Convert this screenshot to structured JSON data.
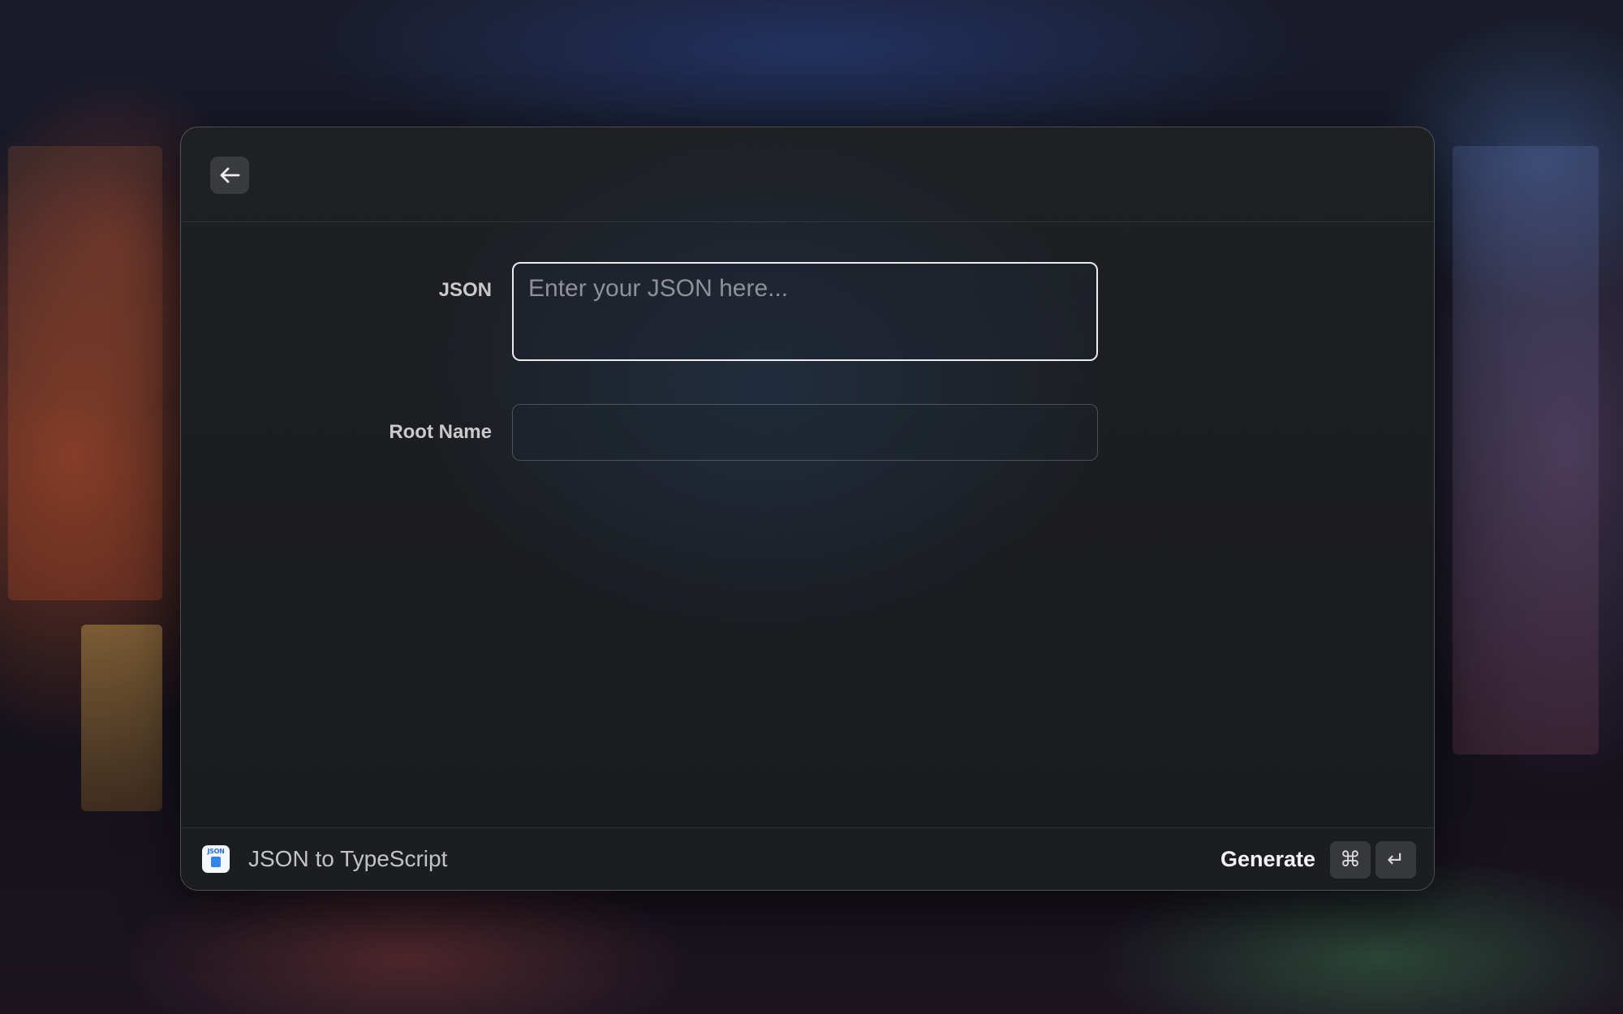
{
  "header": {
    "back_icon": "arrow-left-icon"
  },
  "form": {
    "json_label": "JSON",
    "json_placeholder": "Enter your JSON here...",
    "json_value": "",
    "root_label": "Root Name",
    "root_placeholder": "",
    "root_value": ""
  },
  "footer": {
    "extension_icon": "json-to-typescript-icon",
    "extension_icon_text": "JSON",
    "extension_title": "JSON to TypeScript",
    "primary_action": "Generate",
    "shortcut_modifier": "⌘",
    "shortcut_key": "↵"
  },
  "colors": {
    "accent_border": "#ececef",
    "extension_blue": "#2f86e8"
  }
}
